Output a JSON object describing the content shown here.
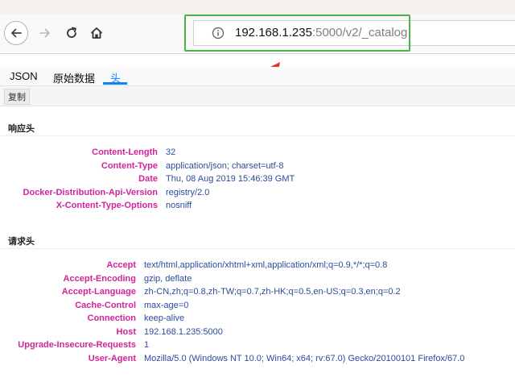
{
  "browser": {
    "url": {
      "host": "192.168.1.235",
      "path": ":5000/v2/_catalog"
    },
    "icons": {
      "back": "arrow-left-icon",
      "forward": "arrow-right-icon",
      "reload": "reload-icon",
      "home": "home-icon",
      "info": "info-icon"
    }
  },
  "tabs": [
    {
      "label": "JSON",
      "active": false
    },
    {
      "label": "原始数据",
      "active": false
    },
    {
      "label": "头",
      "active": true
    }
  ],
  "toolbar": {
    "copy_label": "复制"
  },
  "response_headers": {
    "title": "响应头",
    "rows": [
      {
        "name": "Content-Length",
        "value": "32"
      },
      {
        "name": "Content-Type",
        "value": "application/json; charset=utf-8"
      },
      {
        "name": "Date",
        "value": "Thu, 08 Aug 2019 15:46:39 GMT"
      },
      {
        "name": "Docker-Distribution-Api-Version",
        "value": "registry/2.0"
      },
      {
        "name": "X-Content-Type-Options",
        "value": "nosniff"
      }
    ]
  },
  "request_headers": {
    "title": "请求头",
    "rows": [
      {
        "name": "Accept",
        "value": "text/html,application/xhtml+xml,application/xml;q=0.9,*/*;q=0.8"
      },
      {
        "name": "Accept-Encoding",
        "value": "gzip, deflate"
      },
      {
        "name": "Accept-Language",
        "value": "zh-CN,zh;q=0.8,zh-TW;q=0.7,zh-HK;q=0.5,en-US;q=0.3,en;q=0.2"
      },
      {
        "name": "Cache-Control",
        "value": "max-age=0"
      },
      {
        "name": "Connection",
        "value": "keep-alive"
      },
      {
        "name": "Host",
        "value": "192.168.1.235:5000"
      },
      {
        "name": "Upgrade-Insecure-Requests",
        "value": "1"
      },
      {
        "name": "User-Agent",
        "value": "Mozilla/5.0 (Windows NT 10.0; Win64; x64; rv:67.0) Gecko/20100101 Firefox/67.0"
      }
    ]
  },
  "colors": {
    "header_name": "#d1239c",
    "header_value": "#2a4c9e",
    "annotation_box": "#4bb34b",
    "annotation_arrow": "#e8322c",
    "tab_active": "#0a84ff"
  }
}
